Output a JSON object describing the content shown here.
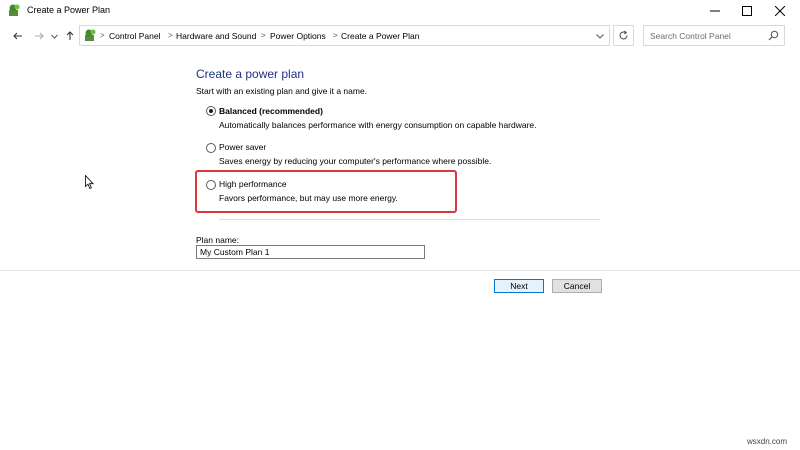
{
  "window": {
    "title": "Create a Power Plan"
  },
  "address_bar": {
    "breadcrumbs": [
      "Control Panel",
      "Hardware and Sound",
      "Power Options",
      "Create a Power Plan"
    ],
    "search_placeholder": "Search Control Panel"
  },
  "content": {
    "heading": "Create a power plan",
    "intro": "Start with an existing plan and give it a name.",
    "options": [
      {
        "label": "Balanced (recommended)",
        "description": "Automatically balances performance with energy consumption on capable hardware.",
        "selected": true
      },
      {
        "label": "Power saver",
        "description": "Saves energy by reducing your computer's performance where possible.",
        "selected": false
      },
      {
        "label": "High performance",
        "description": "Favors performance, but may use more energy.",
        "selected": false
      }
    ],
    "plan_name_label": "Plan name:",
    "plan_name_value": "My Custom Plan 1"
  },
  "buttons": {
    "next": "Next",
    "cancel": "Cancel"
  },
  "watermark": "wsxdn.com",
  "colors": {
    "heading": "#1e3287",
    "highlight": "#d9363e",
    "primary_button_border": "#0078d7"
  }
}
